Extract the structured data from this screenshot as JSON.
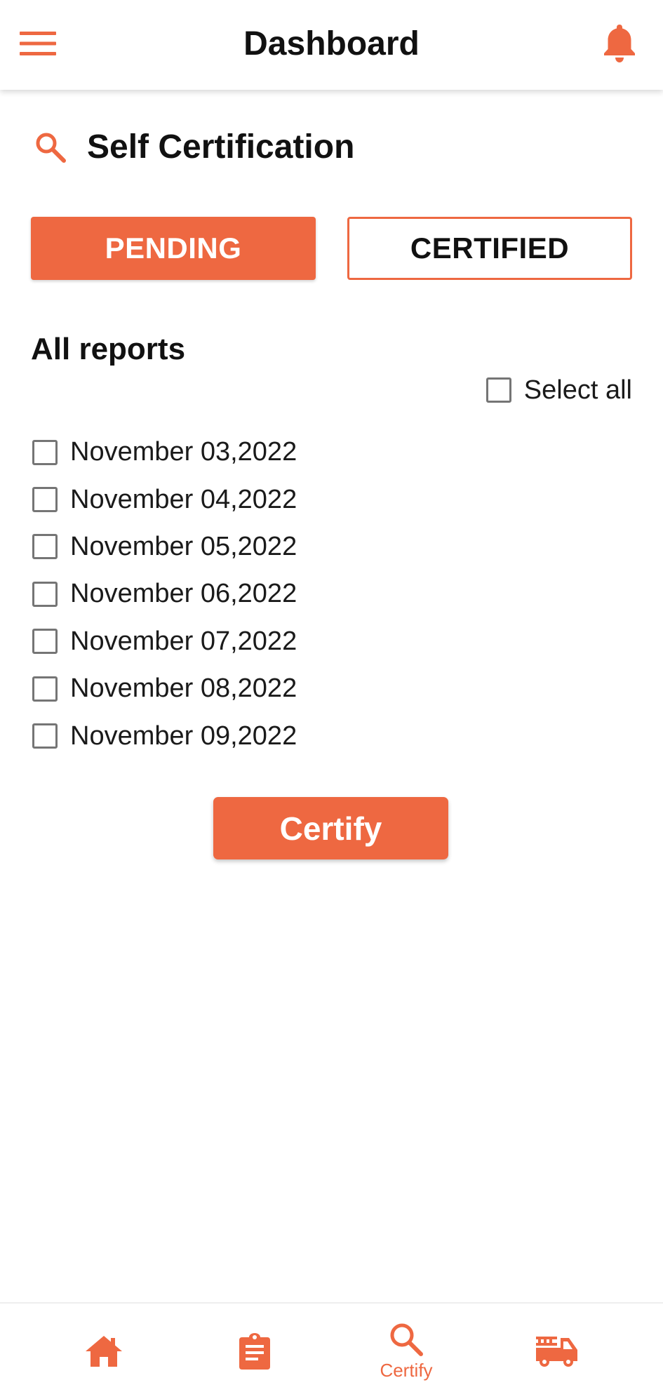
{
  "app_bar": {
    "title": "Dashboard",
    "menu_icon": "hamburger-menu-icon",
    "notification_icon": "bell-icon"
  },
  "section": {
    "icon": "search-icon",
    "title": "Self Certification"
  },
  "tabs": {
    "pending_label": "PENDING",
    "certified_label": "CERTIFIED",
    "active": "PENDING"
  },
  "reports": {
    "title": "All reports",
    "select_all_label": "Select all",
    "select_all_checked": false,
    "items": [
      {
        "label": "November 03,2022",
        "checked": false
      },
      {
        "label": "November 04,2022",
        "checked": false
      },
      {
        "label": "November 05,2022",
        "checked": false
      },
      {
        "label": "November 06,2022",
        "checked": false
      },
      {
        "label": "November 07,2022",
        "checked": false
      },
      {
        "label": "November 08,2022",
        "checked": false
      },
      {
        "label": "November 09,2022",
        "checked": false
      }
    ]
  },
  "actions": {
    "certify_label": "Certify"
  },
  "bottom_nav": {
    "items": [
      {
        "icon": "home-icon",
        "label": ""
      },
      {
        "icon": "clipboard-icon",
        "label": ""
      },
      {
        "icon": "search-icon",
        "label": "Certify"
      },
      {
        "icon": "fire-truck-icon",
        "label": ""
      }
    ],
    "active": "Certify"
  },
  "colors": {
    "accent": "#EE6841",
    "text": "#111111",
    "checkbox_border": "#757575",
    "background": "#FFFFFF"
  }
}
